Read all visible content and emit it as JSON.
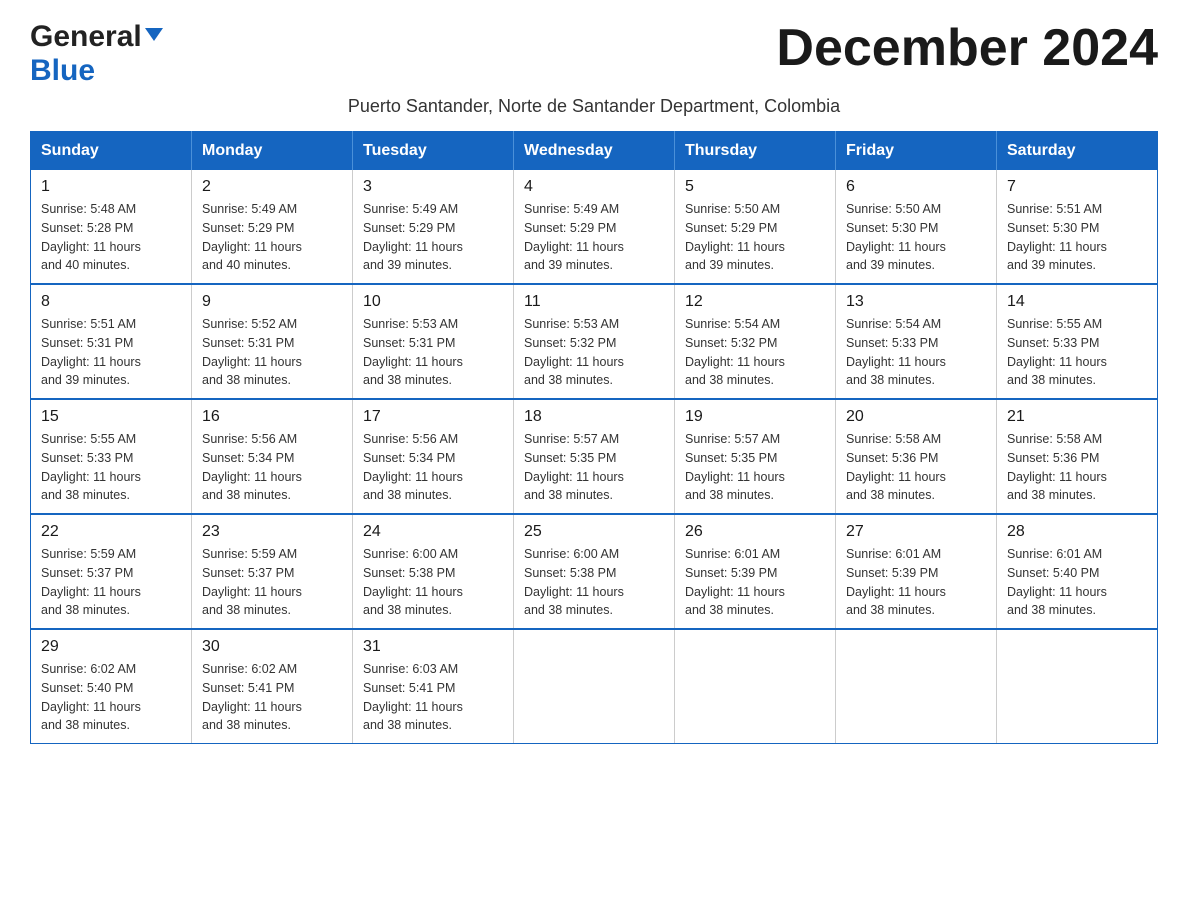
{
  "logo": {
    "general": "General",
    "blue": "Blue"
  },
  "title": "December 2024",
  "subtitle": "Puerto Santander, Norte de Santander Department, Colombia",
  "days_of_week": [
    "Sunday",
    "Monday",
    "Tuesday",
    "Wednesday",
    "Thursday",
    "Friday",
    "Saturday"
  ],
  "weeks": [
    [
      {
        "day": "1",
        "sunrise": "5:48 AM",
        "sunset": "5:28 PM",
        "daylight": "11 hours and 40 minutes."
      },
      {
        "day": "2",
        "sunrise": "5:49 AM",
        "sunset": "5:29 PM",
        "daylight": "11 hours and 40 minutes."
      },
      {
        "day": "3",
        "sunrise": "5:49 AM",
        "sunset": "5:29 PM",
        "daylight": "11 hours and 39 minutes."
      },
      {
        "day": "4",
        "sunrise": "5:49 AM",
        "sunset": "5:29 PM",
        "daylight": "11 hours and 39 minutes."
      },
      {
        "day": "5",
        "sunrise": "5:50 AM",
        "sunset": "5:29 PM",
        "daylight": "11 hours and 39 minutes."
      },
      {
        "day": "6",
        "sunrise": "5:50 AM",
        "sunset": "5:30 PM",
        "daylight": "11 hours and 39 minutes."
      },
      {
        "day": "7",
        "sunrise": "5:51 AM",
        "sunset": "5:30 PM",
        "daylight": "11 hours and 39 minutes."
      }
    ],
    [
      {
        "day": "8",
        "sunrise": "5:51 AM",
        "sunset": "5:31 PM",
        "daylight": "11 hours and 39 minutes."
      },
      {
        "day": "9",
        "sunrise": "5:52 AM",
        "sunset": "5:31 PM",
        "daylight": "11 hours and 38 minutes."
      },
      {
        "day": "10",
        "sunrise": "5:53 AM",
        "sunset": "5:31 PM",
        "daylight": "11 hours and 38 minutes."
      },
      {
        "day": "11",
        "sunrise": "5:53 AM",
        "sunset": "5:32 PM",
        "daylight": "11 hours and 38 minutes."
      },
      {
        "day": "12",
        "sunrise": "5:54 AM",
        "sunset": "5:32 PM",
        "daylight": "11 hours and 38 minutes."
      },
      {
        "day": "13",
        "sunrise": "5:54 AM",
        "sunset": "5:33 PM",
        "daylight": "11 hours and 38 minutes."
      },
      {
        "day": "14",
        "sunrise": "5:55 AM",
        "sunset": "5:33 PM",
        "daylight": "11 hours and 38 minutes."
      }
    ],
    [
      {
        "day": "15",
        "sunrise": "5:55 AM",
        "sunset": "5:33 PM",
        "daylight": "11 hours and 38 minutes."
      },
      {
        "day": "16",
        "sunrise": "5:56 AM",
        "sunset": "5:34 PM",
        "daylight": "11 hours and 38 minutes."
      },
      {
        "day": "17",
        "sunrise": "5:56 AM",
        "sunset": "5:34 PM",
        "daylight": "11 hours and 38 minutes."
      },
      {
        "day": "18",
        "sunrise": "5:57 AM",
        "sunset": "5:35 PM",
        "daylight": "11 hours and 38 minutes."
      },
      {
        "day": "19",
        "sunrise": "5:57 AM",
        "sunset": "5:35 PM",
        "daylight": "11 hours and 38 minutes."
      },
      {
        "day": "20",
        "sunrise": "5:58 AM",
        "sunset": "5:36 PM",
        "daylight": "11 hours and 38 minutes."
      },
      {
        "day": "21",
        "sunrise": "5:58 AM",
        "sunset": "5:36 PM",
        "daylight": "11 hours and 38 minutes."
      }
    ],
    [
      {
        "day": "22",
        "sunrise": "5:59 AM",
        "sunset": "5:37 PM",
        "daylight": "11 hours and 38 minutes."
      },
      {
        "day": "23",
        "sunrise": "5:59 AM",
        "sunset": "5:37 PM",
        "daylight": "11 hours and 38 minutes."
      },
      {
        "day": "24",
        "sunrise": "6:00 AM",
        "sunset": "5:38 PM",
        "daylight": "11 hours and 38 minutes."
      },
      {
        "day": "25",
        "sunrise": "6:00 AM",
        "sunset": "5:38 PM",
        "daylight": "11 hours and 38 minutes."
      },
      {
        "day": "26",
        "sunrise": "6:01 AM",
        "sunset": "5:39 PM",
        "daylight": "11 hours and 38 minutes."
      },
      {
        "day": "27",
        "sunrise": "6:01 AM",
        "sunset": "5:39 PM",
        "daylight": "11 hours and 38 minutes."
      },
      {
        "day": "28",
        "sunrise": "6:01 AM",
        "sunset": "5:40 PM",
        "daylight": "11 hours and 38 minutes."
      }
    ],
    [
      {
        "day": "29",
        "sunrise": "6:02 AM",
        "sunset": "5:40 PM",
        "daylight": "11 hours and 38 minutes."
      },
      {
        "day": "30",
        "sunrise": "6:02 AM",
        "sunset": "5:41 PM",
        "daylight": "11 hours and 38 minutes."
      },
      {
        "day": "31",
        "sunrise": "6:03 AM",
        "sunset": "5:41 PM",
        "daylight": "11 hours and 38 minutes."
      },
      null,
      null,
      null,
      null
    ]
  ],
  "labels": {
    "sunrise": "Sunrise:",
    "sunset": "Sunset:",
    "daylight": "Daylight:"
  },
  "colors": {
    "header_bg": "#1565c0",
    "header_text": "#ffffff",
    "border": "#1565c0"
  }
}
